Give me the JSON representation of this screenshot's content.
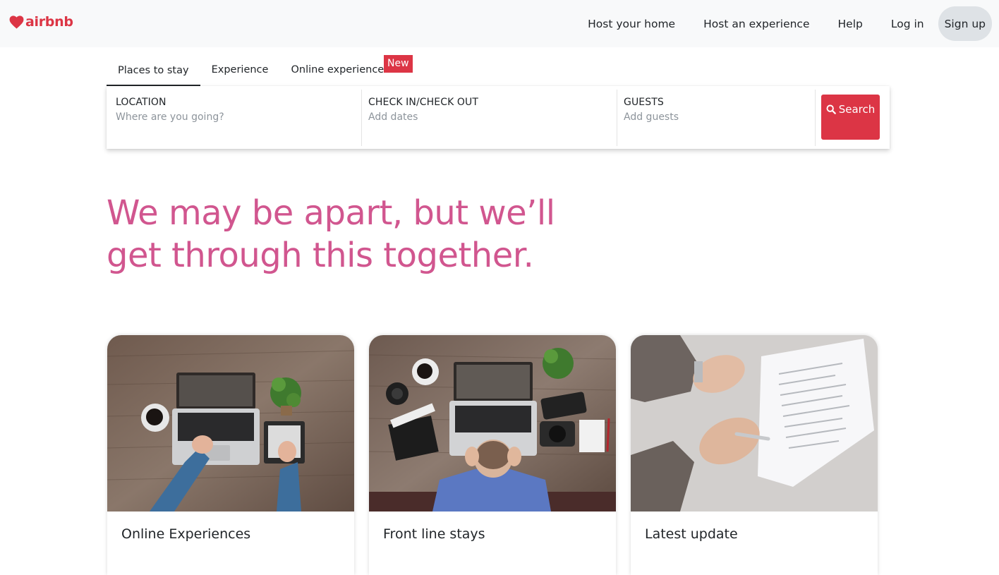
{
  "brand": {
    "name": "airbnb",
    "icon": "heart-icon",
    "color": "#dc3545"
  },
  "nav": {
    "host_home": "Host your home",
    "host_experience": "Host an experience",
    "help": "Help",
    "login": "Log in",
    "signup": "Sign up"
  },
  "tabs": {
    "items": [
      {
        "label": "Places to stay",
        "active": true
      },
      {
        "label": "Experience",
        "active": false
      },
      {
        "label": "Online experience",
        "active": false
      }
    ],
    "new_badge": "New"
  },
  "search": {
    "location": {
      "label": "LOCATION",
      "placeholder": "Where are you going?"
    },
    "dates": {
      "label": "CHECK IN/CHECK OUT",
      "placeholder": "Add dates"
    },
    "guests": {
      "label": "GUESTS",
      "placeholder": "Add guests"
    },
    "button": "Search",
    "button_icon": "search-icon"
  },
  "hero": {
    "line1": "We may be apart, but we’ll",
    "line2": "get through this together.",
    "color": "#d1568f"
  },
  "cards": [
    {
      "title": "Online Experiences"
    },
    {
      "title": "Front line stays"
    },
    {
      "title": "Latest update"
    }
  ]
}
